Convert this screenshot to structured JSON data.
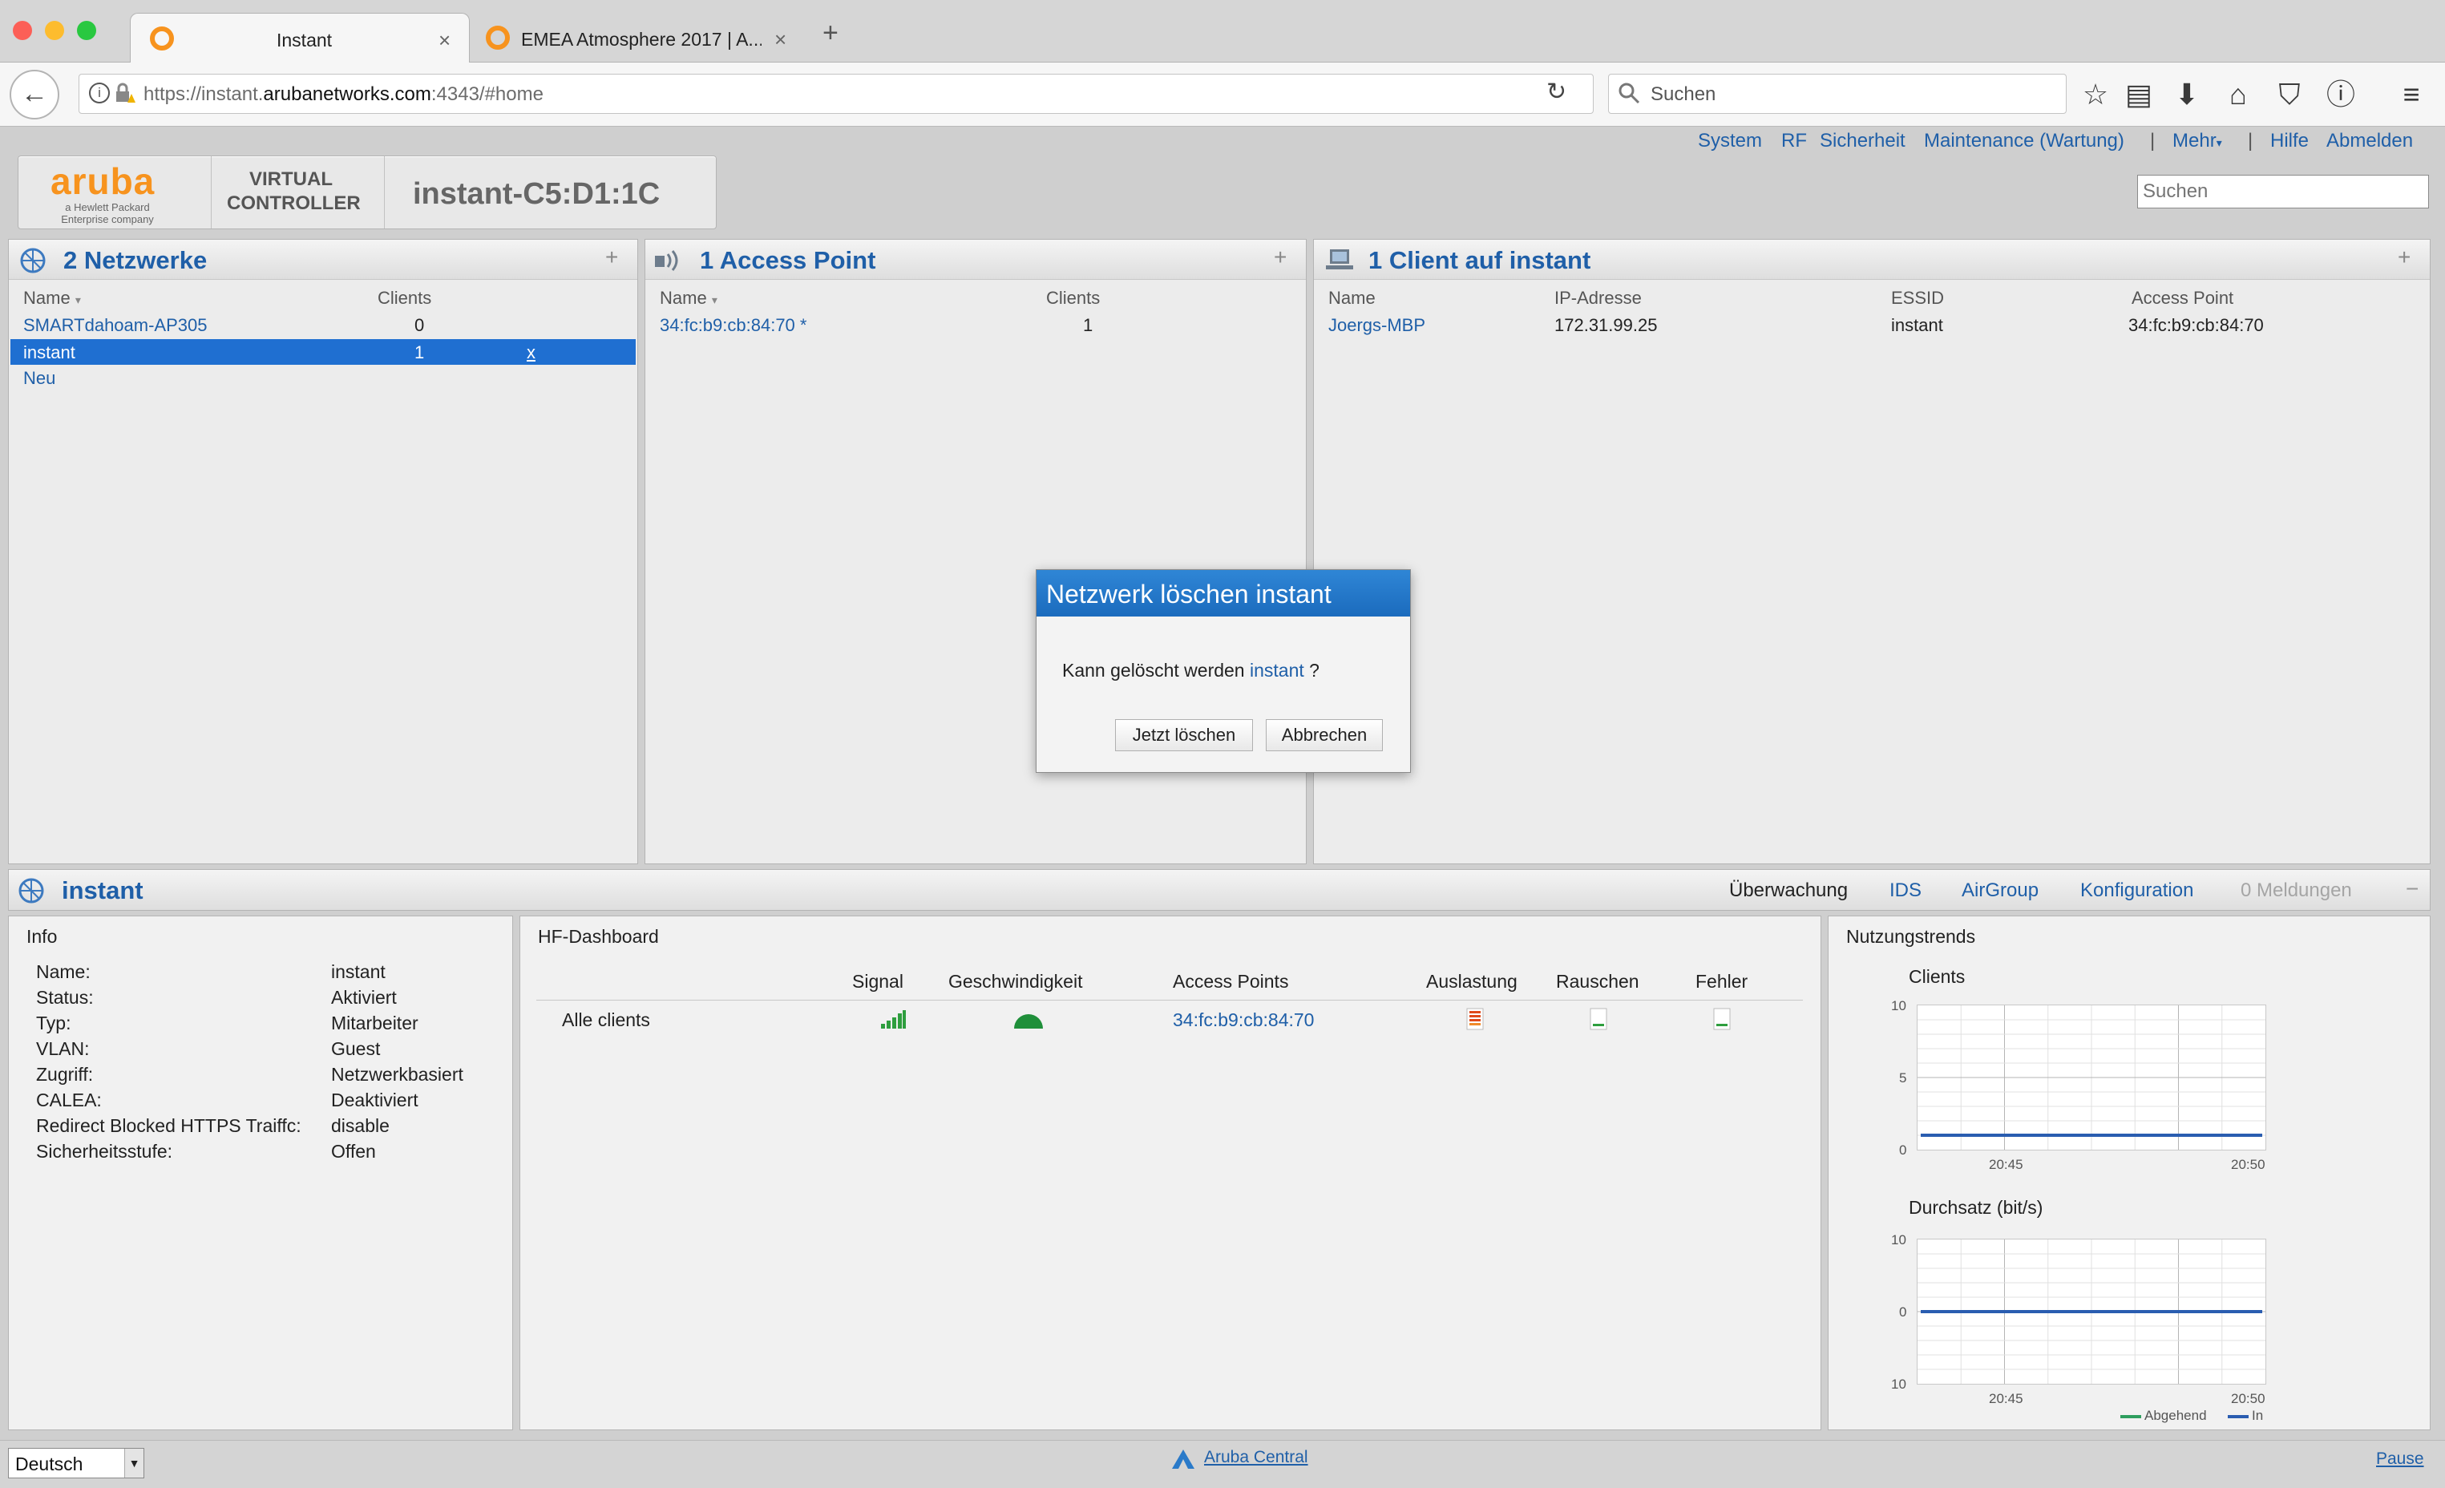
{
  "browser": {
    "tabs": [
      {
        "title": "Instant",
        "active": true
      },
      {
        "title": "EMEA Atmosphere 2017 | A...",
        "active": false
      }
    ],
    "new_tab": "+",
    "url_prefix": "https://instant.",
    "url_domain": "arubanetworks.com",
    "url_suffix": ":4343/#home",
    "search_placeholder": "Suchen"
  },
  "topnav": {
    "links": [
      "System",
      "RF",
      "Sicherheit",
      "Maintenance (Wartung)",
      "Mehr",
      "Hilfe",
      "Abmelden"
    ],
    "search_placeholder": "Suchen"
  },
  "brand": {
    "logo": "aruba",
    "logo_sub1": "a Hewlett Packard",
    "logo_sub2": "Enterprise company",
    "vc_line1": "VIRTUAL",
    "vc_line2": "CONTROLLER",
    "name": "instant-C5:D1:1C"
  },
  "networks": {
    "title": "2 Netzwerke",
    "col_name": "Name",
    "col_clients": "Clients",
    "rows": [
      {
        "name": "SMARTdahoam-AP305",
        "clients": "0"
      },
      {
        "name": "instant",
        "clients": "1",
        "delete": "x"
      }
    ],
    "new_label": "Neu"
  },
  "access_points": {
    "title": "1 Access Point",
    "col_name": "Name",
    "col_clients": "Clients",
    "rows": [
      {
        "name": "34:fc:b9:cb:84:70 *",
        "clients": "1"
      }
    ]
  },
  "clients": {
    "title": "1 Client auf instant",
    "cols": [
      "Name",
      "IP-Adresse",
      "ESSID",
      "Access Point"
    ],
    "rows": [
      {
        "name": "Joergs-MBP",
        "ip": "172.31.99.25",
        "essid": "instant",
        "ap": "34:fc:b9:cb:84:70"
      }
    ]
  },
  "dialog": {
    "title": "Netzwerk löschen instant",
    "msg_prefix": "Kann gelöscht werden",
    "msg_link": "instant",
    "msg_suffix": "?",
    "confirm": "Jetzt löschen",
    "cancel": "Abbrechen"
  },
  "detail": {
    "title": "instant",
    "tabs": [
      "Überwachung",
      "IDS",
      "AirGroup",
      "Konfiguration",
      "0 Meldungen"
    ],
    "collapse": "−"
  },
  "info": {
    "title": "Info",
    "rows": [
      {
        "k": "Name:",
        "v": "instant"
      },
      {
        "k": "Status:",
        "v": "Aktiviert"
      },
      {
        "k": "Typ:",
        "v": "Mitarbeiter"
      },
      {
        "k": "VLAN:",
        "v": "Guest"
      },
      {
        "k": "Zugriff:",
        "v": "Netzwerkbasiert"
      },
      {
        "k": "CALEA:",
        "v": "Deaktiviert"
      },
      {
        "k": "Redirect Blocked HTTPS Traiffc:",
        "v": "disable"
      },
      {
        "k": "Sicherheitsstufe:",
        "v": "Offen"
      }
    ]
  },
  "rf": {
    "title": "HF-Dashboard",
    "cols": [
      "Signal",
      "Geschwindigkeit",
      "Access Points",
      "Auslastung",
      "Rauschen",
      "Fehler"
    ],
    "row_label": "Alle clients",
    "ap": "34:fc:b9:cb:84:70",
    "colors": {
      "signal": "#2e9e3e",
      "load": "#e04a1a",
      "ok": "#2e9e3e"
    }
  },
  "trends": {
    "title": "Nutzungstrends",
    "clients_title": "Clients",
    "clients_y": [
      "10",
      "5",
      "0"
    ],
    "clients_x": [
      "20:45",
      "20:50"
    ],
    "throughput_title": "Durchsatz  (bit/s)",
    "throughput_y": [
      "10",
      "0",
      "10"
    ],
    "throughput_x": [
      "20:45",
      "20:50"
    ],
    "legend_out": "Abgehend",
    "legend_in": "In",
    "colors": {
      "out": "#2e9e5e",
      "in": "#2a5db0"
    }
  },
  "chart_data": [
    {
      "type": "line",
      "title": "Clients",
      "x": [
        "20:45",
        "20:50"
      ],
      "series": [
        {
          "values": [
            1,
            1
          ]
        }
      ],
      "ylim": [
        0,
        10
      ]
    },
    {
      "type": "line",
      "title": "Durchsatz  (bit/s)",
      "x": [
        "20:45",
        "20:50"
      ],
      "series": [
        {
          "name": "Abgehend",
          "values": [
            0,
            0
          ]
        },
        {
          "name": "In",
          "values": [
            0,
            0
          ]
        }
      ],
      "ylim": [
        -10,
        10
      ]
    }
  ],
  "footer": {
    "language": "Deutsch",
    "central": "Aruba Central",
    "pause": "Pause"
  }
}
